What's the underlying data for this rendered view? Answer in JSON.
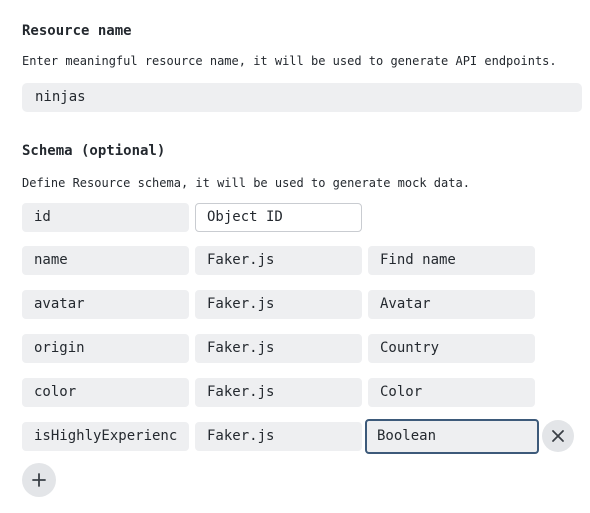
{
  "resource": {
    "title": "Resource name",
    "description": "Enter meaningful resource name, it will be used to generate API endpoints.",
    "value": "ninjas"
  },
  "schema": {
    "title": "Schema (optional)",
    "description": "Define Resource schema, it will be used to generate mock data.",
    "rows": [
      {
        "name": "id",
        "generator": "Object ID",
        "method": ""
      },
      {
        "name": "name",
        "generator": "Faker.js",
        "method": "Find name"
      },
      {
        "name": "avatar",
        "generator": "Faker.js",
        "method": "Avatar"
      },
      {
        "name": "origin",
        "generator": "Faker.js",
        "method": "Country"
      },
      {
        "name": "color",
        "generator": "Faker.js",
        "method": "Color"
      },
      {
        "name": "isHighlyExperienc",
        "generator": "Faker.js",
        "method": "Boolean"
      }
    ],
    "icons": {
      "remove": "close-icon",
      "add": "plus-icon"
    }
  }
}
